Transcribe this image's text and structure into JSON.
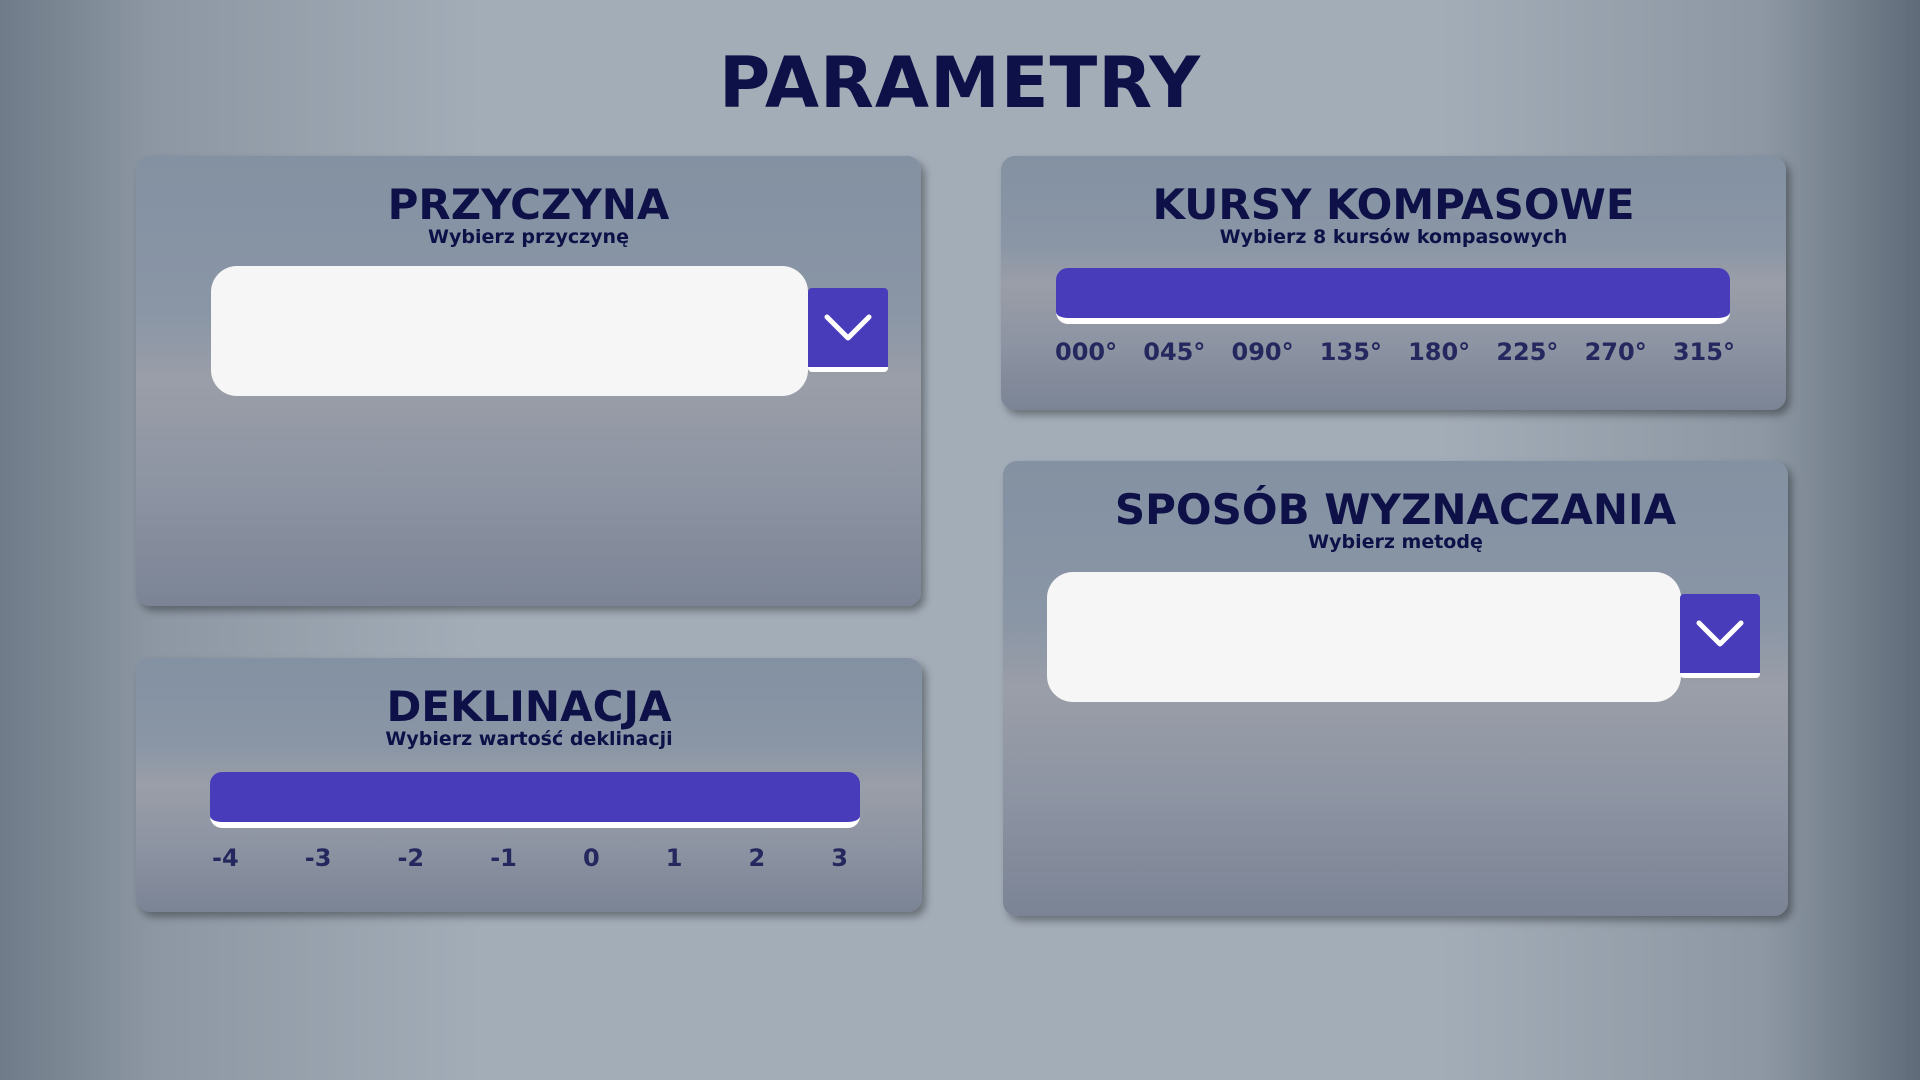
{
  "page": {
    "title": "PARAMETRY"
  },
  "przyczyna": {
    "title": "PRZYCZYNA",
    "subtitle": "Wybierz przyczynę",
    "selected_value": ""
  },
  "kursy": {
    "title": "KURSY KOMPASOWE",
    "subtitle": "Wybierz 8 kursów kompasowych",
    "ticks": [
      "000°",
      "045°",
      "090°",
      "135°",
      "180°",
      "225°",
      "270°",
      "315°"
    ]
  },
  "deklinacja": {
    "title": "DEKLINACJA",
    "subtitle": "Wybierz wartość deklinacji",
    "ticks": [
      "-4",
      "-3",
      "-2",
      "-1",
      "0",
      "1",
      "2",
      "3"
    ]
  },
  "sposob": {
    "title": "SPOSÓB WYZNACZANIA",
    "subtitle": "Wybierz metodę",
    "selected_value": ""
  },
  "icons": {
    "dropdown": "chevron-down-icon"
  },
  "colors": {
    "accent": "#483cbb",
    "title": "#0d1148"
  }
}
